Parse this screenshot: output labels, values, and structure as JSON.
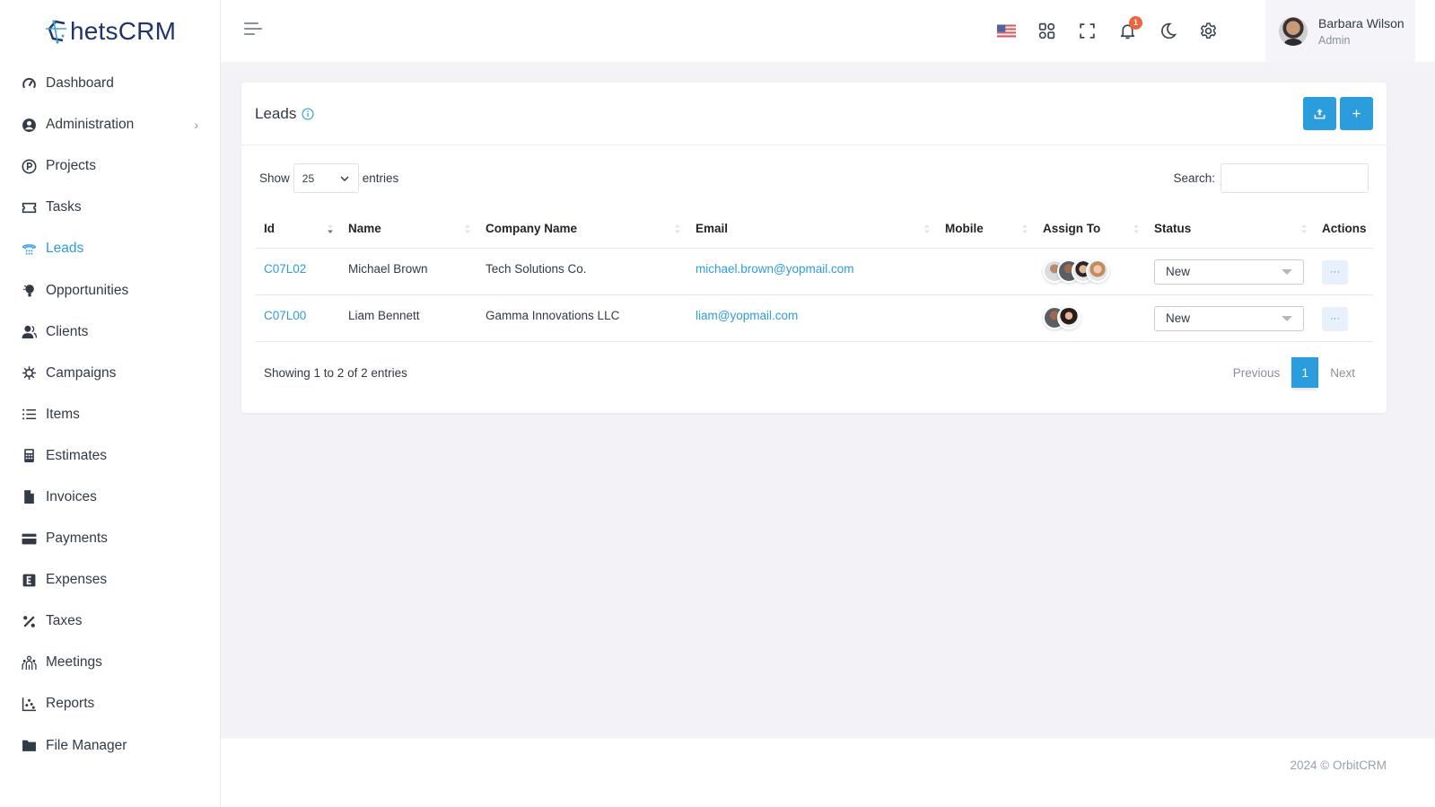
{
  "app": {
    "logo_text": "hetsCRM",
    "brand_color": "#2e9ce0",
    "logo_color": "#22356b"
  },
  "sidebar": {
    "items": [
      {
        "label": "Dashboard",
        "icon": "speedometer-icon"
      },
      {
        "label": "Administration",
        "icon": "user-circle-icon",
        "has_submenu": true
      },
      {
        "label": "Projects",
        "icon": "p-circle-icon"
      },
      {
        "label": "Tasks",
        "icon": "ticket-icon"
      },
      {
        "label": "Leads",
        "icon": "phone-icon",
        "active": true
      },
      {
        "label": "Opportunities",
        "icon": "lightbulb-icon"
      },
      {
        "label": "Clients",
        "icon": "users-icon"
      },
      {
        "label": "Campaigns",
        "icon": "virus-icon"
      },
      {
        "label": "Items",
        "icon": "list-icon"
      },
      {
        "label": "Estimates",
        "icon": "calculator-icon"
      },
      {
        "label": "Invoices",
        "icon": "file-icon"
      },
      {
        "label": "Payments",
        "icon": "credit-card-icon"
      },
      {
        "label": "Expenses",
        "icon": "e-square-icon"
      },
      {
        "label": "Taxes",
        "icon": "percent-icon"
      },
      {
        "label": "Meetings",
        "icon": "group-icon"
      },
      {
        "label": "Reports",
        "icon": "scatter-chart-icon"
      },
      {
        "label": "File Manager",
        "icon": "folder-icon"
      }
    ]
  },
  "topbar": {
    "notifications_count": "1",
    "user": {
      "name": "Barbara Wilson",
      "role": "Admin"
    }
  },
  "leads": {
    "title": "Leads",
    "show_label": "Show",
    "entries_label": "entries",
    "page_size": "25",
    "search_label": "Search:",
    "search_value": "",
    "columns": [
      "Id",
      "Name",
      "Company Name",
      "Email",
      "Mobile",
      "Assign To",
      "Status",
      "Actions"
    ],
    "rows": [
      {
        "id": "C07L02",
        "name": "Michael Brown",
        "company": "Tech Solutions Co.",
        "email": "michael.brown@yopmail.com",
        "mobile": "",
        "assignees": 4,
        "status": "New",
        "actions": "···"
      },
      {
        "id": "C07L00",
        "name": "Liam Bennett",
        "company": "Gamma Innovations LLC",
        "email": "liam@yopmail.com",
        "mobile": "",
        "assignees": 2,
        "status": "New",
        "actions": "···"
      }
    ],
    "summary": "Showing 1 to 2 of 2 entries",
    "pagination": {
      "previous": "Previous",
      "current": "1",
      "next": "Next"
    }
  },
  "footer": {
    "text": "2024 © OrbitCRM"
  }
}
